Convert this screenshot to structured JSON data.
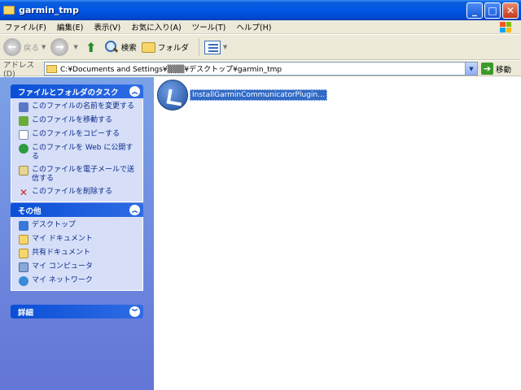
{
  "window": {
    "title": "garmin_tmp"
  },
  "menu": [
    "ファイル(F)",
    "編集(E)",
    "表示(V)",
    "お気に入り(A)",
    "ツール(T)",
    "ヘルプ(H)"
  ],
  "toolbar": {
    "back_label": "戻る",
    "search_label": "検索",
    "folders_label": "フォルダ"
  },
  "address": {
    "label": "アドレス(D)",
    "value": "C:¥Documents and Settings¥▒▒▒¥デスクトップ¥garmin_tmp",
    "go_label": "移動"
  },
  "panels": {
    "file_tasks": {
      "title": "ファイルとフォルダのタスク",
      "items": [
        "このファイルの名前を変更する",
        "このファイルを移動する",
        "このファイルをコピーする",
        "このファイルを Web に公開する",
        "このファイルを電子メールで送信する",
        "このファイルを削除する"
      ]
    },
    "other": {
      "title": "その他",
      "items": [
        "デスクトップ",
        "マイ ドキュメント",
        "共有ドキュメント",
        "マイ コンピュータ",
        "マイ ネットワーク"
      ]
    },
    "details": {
      "title": "詳細"
    }
  },
  "files": [
    {
      "name": "InstallGarminCommunicatorPlugin...",
      "icon": "installer-icon"
    }
  ]
}
